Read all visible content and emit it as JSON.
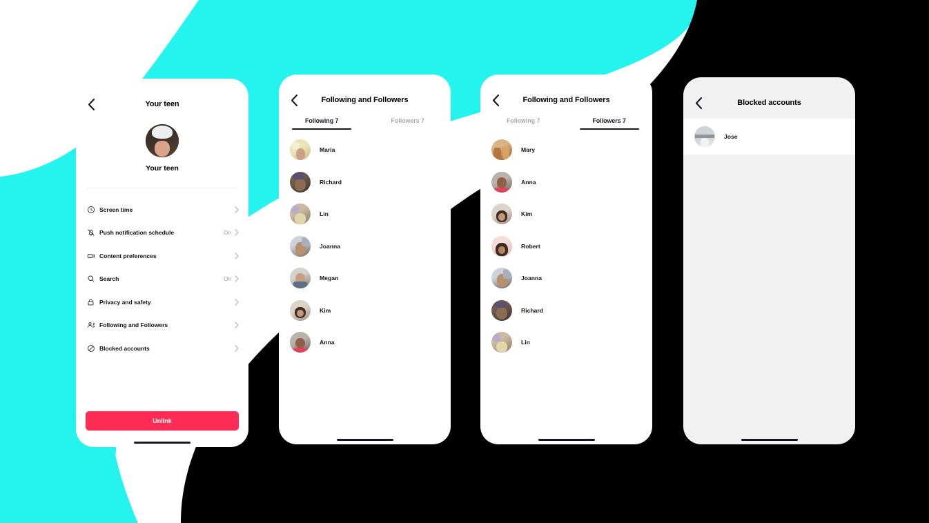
{
  "background": {
    "colors": {
      "white": "#ffffff",
      "cyan": "#25f4ee",
      "black": "#000000",
      "red": "#fe2c55"
    }
  },
  "phone_teen": {
    "nav": {
      "back_icon": "chevron-left-icon",
      "title": "Your teen"
    },
    "profile": {
      "name": "Your teen",
      "avatar": "teen-avatar"
    },
    "settings": [
      {
        "icon": "clock-icon",
        "label": "Screen time",
        "value": ""
      },
      {
        "icon": "bell-off-icon",
        "label": "Push notification schedule",
        "value": "On"
      },
      {
        "icon": "video-icon",
        "label": "Content preferences",
        "value": ""
      },
      {
        "icon": "search-icon",
        "label": "Search",
        "value": "On"
      },
      {
        "icon": "lock-icon",
        "label": "Privacy and safety",
        "value": ""
      },
      {
        "icon": "people-icon",
        "label": "Following and Followers",
        "value": ""
      },
      {
        "icon": "ban-icon",
        "label": "Blocked accounts",
        "value": ""
      }
    ],
    "unlink_label": "Unlink"
  },
  "phone_following": {
    "nav": {
      "back_icon": "chevron-left-icon",
      "title": "Following and Followers"
    },
    "tabs": [
      {
        "label": "Following 7",
        "active": true
      },
      {
        "label": "Followers 7",
        "active": false
      }
    ],
    "users": [
      {
        "name": "Maria",
        "avatar": "ph-maria"
      },
      {
        "name": "Richard",
        "avatar": "ph-richard"
      },
      {
        "name": "Lin",
        "avatar": "ph-lin"
      },
      {
        "name": "Joanna",
        "avatar": "ph-joanna"
      },
      {
        "name": "Megan",
        "avatar": "ph-megan"
      },
      {
        "name": "Kim",
        "avatar": "ph-kim"
      },
      {
        "name": "Anna",
        "avatar": "ph-anna"
      }
    ]
  },
  "phone_followers": {
    "nav": {
      "back_icon": "chevron-left-icon",
      "title": "Following and Followers"
    },
    "tabs": [
      {
        "label": "Following 7",
        "active": false
      },
      {
        "label": "Followers 7",
        "active": true
      }
    ],
    "users": [
      {
        "name": "Mary",
        "avatar": "ph-mary"
      },
      {
        "name": "Anna",
        "avatar": "ph-anna"
      },
      {
        "name": "Kim",
        "avatar": "ph-kim"
      },
      {
        "name": "Robert",
        "avatar": "ph-robert"
      },
      {
        "name": "Joanna",
        "avatar": "ph-joanna"
      },
      {
        "name": "Richard",
        "avatar": "ph-richard"
      },
      {
        "name": "Lin",
        "avatar": "ph-lin"
      }
    ]
  },
  "phone_blocked": {
    "nav": {
      "back_icon": "chevron-left-icon",
      "title": "Blocked accounts"
    },
    "users": [
      {
        "name": "Jose",
        "avatar": "ph-jose"
      }
    ]
  }
}
